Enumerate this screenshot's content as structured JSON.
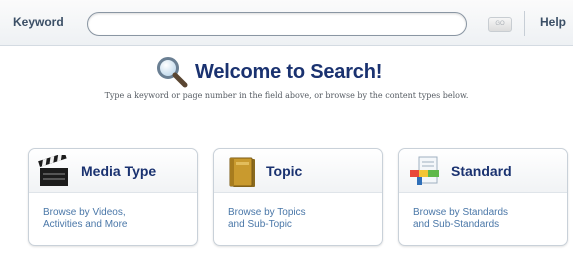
{
  "search": {
    "keyword_label": "Keyword",
    "input_value": "",
    "input_placeholder": "",
    "go_label": "GO",
    "help_label": "Help"
  },
  "welcome": {
    "title": "Welcome to Search!",
    "subtitle": "Type a keyword or page number in the field above, or browse by the content types below.",
    "icon": "magnifying-glass-icon"
  },
  "cards": [
    {
      "title": "Media Type",
      "icon": "clapperboard-icon",
      "desc_line1": "Browse by Videos,",
      "desc_line2": "Activities and More"
    },
    {
      "title": "Topic",
      "icon": "book-icon",
      "desc_line1": "Browse by Topics",
      "desc_line2": "and Sub-Topic"
    },
    {
      "title": "Standard",
      "icon": "standards-document-icon",
      "desc_line1": "Browse by Standards",
      "desc_line2": "and Sub-Standards"
    }
  ],
  "colors": {
    "title": "#1a3270",
    "link": "#4a77a8",
    "label": "#3b4f66"
  }
}
